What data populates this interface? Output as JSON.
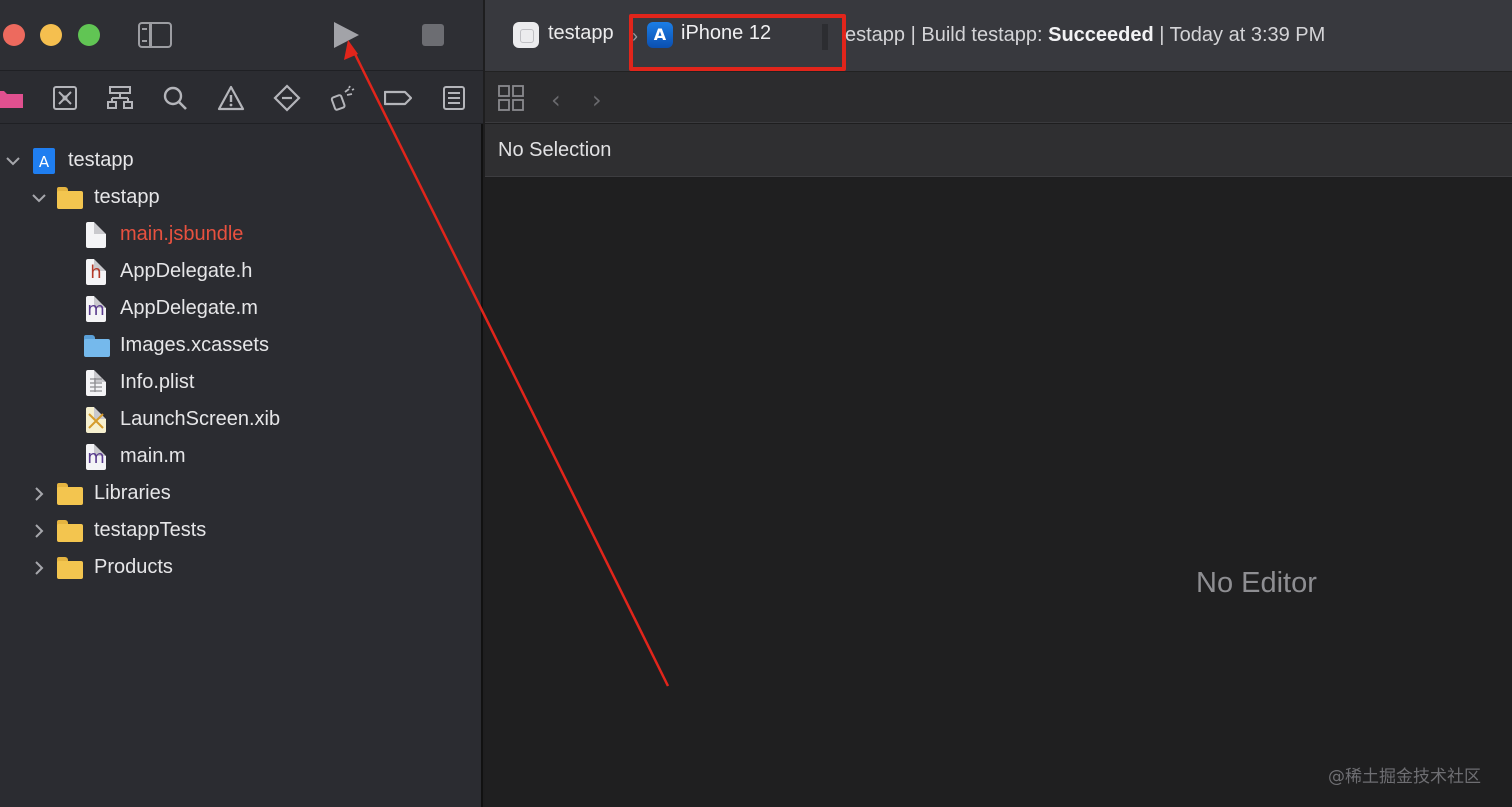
{
  "toolbar": {
    "scheme_name": "testapp",
    "scheme_separator": "›",
    "device_name": "iPhone 12",
    "status_prefix": "estapp | Build testapp: ",
    "status_result": "Succeeded",
    "status_suffix": " | Today at 3:39 PM"
  },
  "navigator_tabs": [
    "folder-icon",
    "source-control-icon",
    "hierarchy-icon",
    "search-icon",
    "warning-icon",
    "test-diamond-icon",
    "debug-spray-icon",
    "breakpoint-icon",
    "report-icon"
  ],
  "tree": {
    "project": "testapp",
    "group": "testapp",
    "files": [
      {
        "name": "main.jsbundle",
        "glyph": "",
        "color": "#e8513f"
      },
      {
        "name": "AppDelegate.h",
        "glyph": "h",
        "color": "#e6e6e8"
      },
      {
        "name": "AppDelegate.m",
        "glyph": "m",
        "color": "#e6e6e8"
      },
      {
        "name": "Images.xcassets",
        "glyph": "",
        "color": "#e6e6e8"
      },
      {
        "name": "Info.plist",
        "glyph": "",
        "color": "#e6e6e8"
      },
      {
        "name": "LaunchScreen.xib",
        "glyph": "",
        "color": "#e6e6e8"
      },
      {
        "name": "main.m",
        "glyph": "m",
        "color": "#e6e6e8"
      }
    ],
    "collapsed_groups": [
      "Libraries",
      "testappTests",
      "Products"
    ]
  },
  "editor": {
    "selection_text": "No Selection",
    "empty_text": "No Editor"
  },
  "watermark": "@稀土掘金技术社区",
  "colors": {
    "annotation_red": "#e1251b",
    "accent_blue": "#1b7ee6"
  }
}
